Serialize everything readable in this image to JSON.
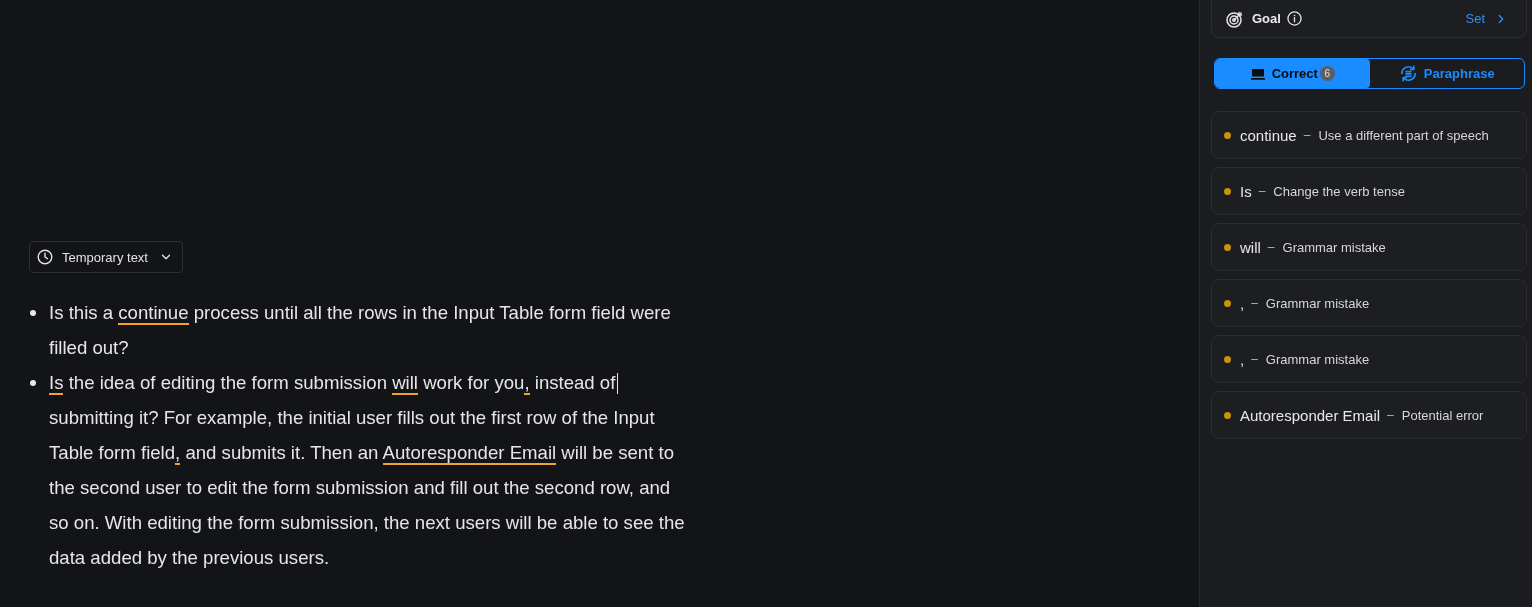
{
  "editor": {
    "mode_dropdown": {
      "label": "Temporary text"
    },
    "bullets": [
      {
        "segments": [
          {
            "kind": "text",
            "text": "Is this a "
          },
          {
            "kind": "flagged",
            "text": "continue"
          },
          {
            "kind": "text",
            "text": " process until all the rows in the Input Table form field were filled out?"
          }
        ]
      },
      {
        "segments": [
          {
            "kind": "flagged",
            "text": "Is"
          },
          {
            "kind": "text",
            "text": " the idea of editing the form submission "
          },
          {
            "kind": "flagged",
            "text": "will"
          },
          {
            "kind": "text",
            "text": " work for you"
          },
          {
            "kind": "flagged",
            "text": ","
          },
          {
            "kind": "text",
            "text": " instead of"
          },
          {
            "kind": "cursor"
          },
          {
            "kind": "text",
            "text": " submitting it? For example, the initial user fills out the first row of the Input Table form field"
          },
          {
            "kind": "flagged",
            "text": ","
          },
          {
            "kind": "text",
            "text": " and submits it. Then an "
          },
          {
            "kind": "flagged",
            "text": "Autoresponder Email"
          },
          {
            "kind": "text",
            "text": " will be sent to the second user to edit the form submission and fill out the second row, and so on. With editing the form submission, the next users will be able to see the data added by the previous users."
          }
        ]
      }
    ]
  },
  "sidebar": {
    "goal": {
      "label": "Goal",
      "action": "Set"
    },
    "tabs": [
      {
        "kind": "correct",
        "label": "Correct",
        "badge": "6",
        "selected": true
      },
      {
        "kind": "paraphrase",
        "label": "Paraphrase",
        "selected": false
      }
    ],
    "suggestions": [
      {
        "word": "continue",
        "dash": "–",
        "description": "Use a different part of speech"
      },
      {
        "word": "Is",
        "dash": "–",
        "description": "Change the verb tense"
      },
      {
        "word": "will",
        "dash": "–",
        "description": "Grammar mistake"
      },
      {
        "word": ",",
        "dash": "–",
        "description": "Grammar mistake"
      },
      {
        "word": ",",
        "dash": "–",
        "description": "Grammar mistake"
      },
      {
        "word": "Autoresponder Email",
        "dash": "–",
        "description": "Potential error"
      }
    ]
  }
}
